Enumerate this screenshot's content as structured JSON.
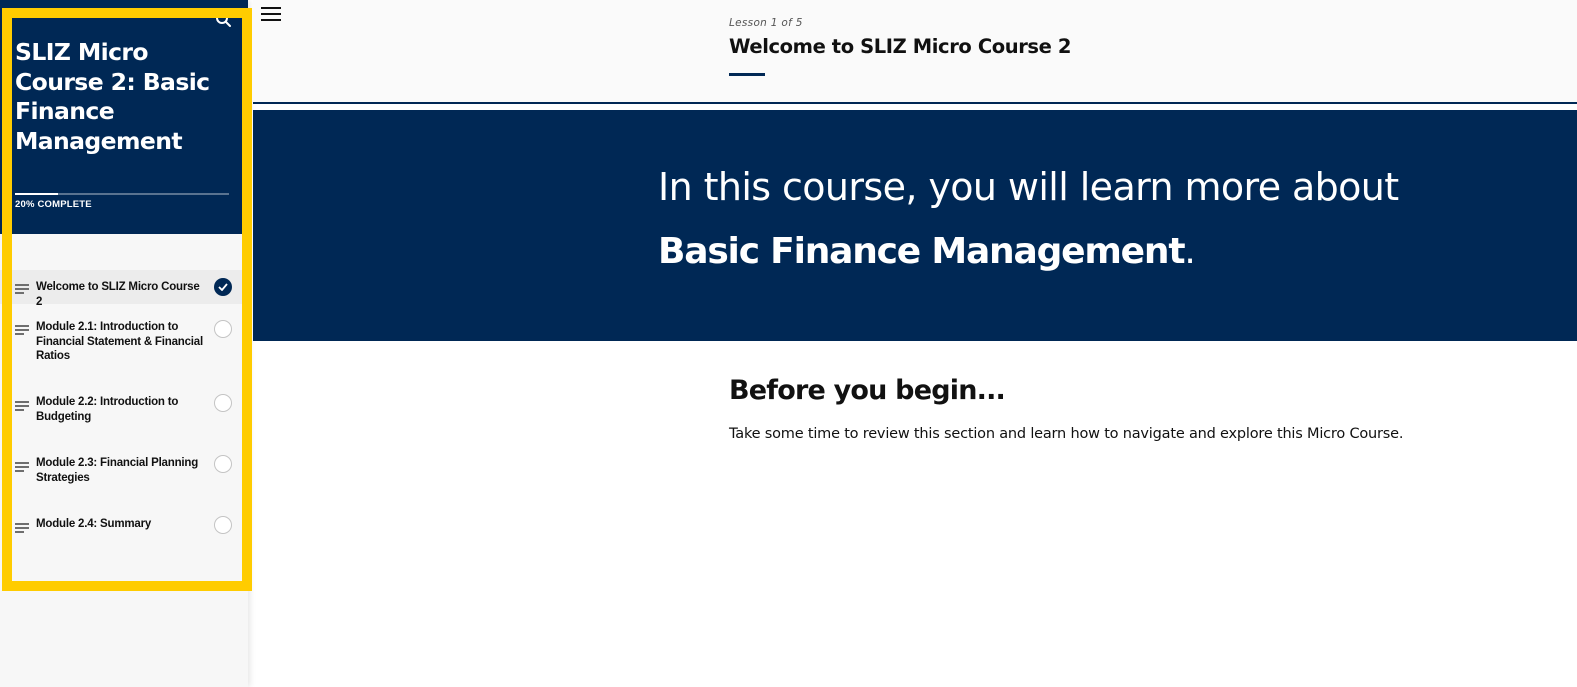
{
  "sidebar": {
    "course_title": "SLIZ Micro Course 2: Basic Finance Management",
    "progress_text": "20% COMPLETE",
    "progress_fraction": 0.2,
    "search_icon": "search-icon",
    "lessons": [
      {
        "title": "Welcome to SLIZ Micro Course 2",
        "completed": true
      },
      {
        "title": "Module 2.1: Introduction to Financial Statement & Financial Ratios",
        "completed": false
      },
      {
        "title": "Module 2.2: Introduction to Budgeting",
        "completed": false
      },
      {
        "title": "Module 2.3: Financial Planning Strategies",
        "completed": false
      },
      {
        "title": "Module 2.4: Summary",
        "completed": false
      }
    ]
  },
  "header": {
    "menu_icon": "hamburger-menu-icon",
    "lesson_count": "Lesson 1 of 5",
    "lesson_title": "Welcome to SLIZ Micro Course 2"
  },
  "banner": {
    "line1": "In this course, you will learn more about",
    "line2_bold": "Basic Finance Management",
    "line2_end": "."
  },
  "content": {
    "heading": "Before you begin...",
    "body": "Take some time to review this section and learn how to navigate and explore this Micro Course."
  },
  "colors": {
    "navy": "#002855",
    "highlight": "#ffcc00",
    "sidebar_bg": "#f7f7f7"
  }
}
